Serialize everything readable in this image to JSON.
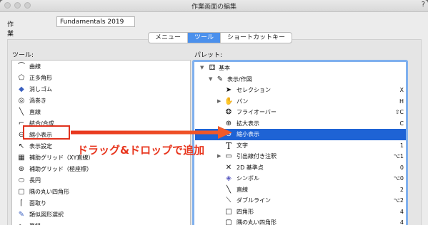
{
  "window": {
    "title": "作業画面の編集",
    "help": "?"
  },
  "name_field": {
    "label": "作業画面の名前:",
    "value": "Fundamentals 2019"
  },
  "tabs": [
    {
      "label": "メニュー",
      "active": false
    },
    {
      "label": "ツール",
      "active": true
    },
    {
      "label": "ショートカットキー",
      "active": false
    }
  ],
  "tools_panel": {
    "header": "ツール:",
    "items": [
      {
        "label": "曲線",
        "icon": "curve-icon"
      },
      {
        "label": "正多角形",
        "icon": "polygon-icon"
      },
      {
        "label": "消しゴム",
        "icon": "eraser-icon"
      },
      {
        "label": "渦巻き",
        "icon": "spiral-icon"
      },
      {
        "label": "直線",
        "icon": "line-icon"
      },
      {
        "label": "結合/合成",
        "icon": "combine-icon"
      },
      {
        "label": "縮小表示",
        "icon": "zoom-out-icon"
      },
      {
        "label": "表示設定",
        "icon": "view-settings-icon"
      },
      {
        "label": "補助グリッド（XY直線）",
        "icon": "grid-icon"
      },
      {
        "label": "補助グリッド（極座標）",
        "icon": "polar-grid-icon"
      },
      {
        "label": "長円",
        "icon": "oval-icon"
      },
      {
        "label": "隅の丸い四角形",
        "icon": "rounded-rect-icon"
      },
      {
        "label": "面取り",
        "icon": "chamfer-icon"
      },
      {
        "label": "類似図形選択",
        "icon": "similar-select-icon"
      },
      {
        "label": "登録",
        "icon": "register-icon"
      }
    ]
  },
  "palette_panel": {
    "header": "パレット:",
    "rows": [
      {
        "label": "基本",
        "shortcut": "",
        "indent": 0,
        "expander": "▼",
        "icon": "basic-icon"
      },
      {
        "label": "表示/作図",
        "shortcut": "",
        "indent": 1,
        "expander": "▼",
        "icon": "pencil-icon"
      },
      {
        "label": "セレクション",
        "shortcut": "X",
        "indent": 2,
        "expander": "",
        "icon": "selection-arrow-icon"
      },
      {
        "label": "パン",
        "shortcut": "H",
        "indent": 2,
        "expander": "▶",
        "icon": "hand-icon"
      },
      {
        "label": "フライオーバー",
        "shortcut": "⇧C",
        "indent": 2,
        "expander": "",
        "icon": "flyover-icon"
      },
      {
        "label": "拡大表示",
        "shortcut": "C",
        "indent": 2,
        "expander": "",
        "icon": "zoom-in-icon"
      },
      {
        "label": "縮小表示",
        "shortcut": "",
        "indent": 2,
        "expander": "",
        "icon": "zoom-out-icon",
        "selected": true
      },
      {
        "label": "文字",
        "shortcut": "1",
        "indent": 2,
        "expander": "",
        "icon": "text-icon"
      },
      {
        "label": "引出線付き注釈",
        "shortcut": "⌥1",
        "indent": 2,
        "expander": "▶",
        "icon": "callout-icon"
      },
      {
        "label": "2D 基準点",
        "shortcut": "0",
        "indent": 2,
        "expander": "",
        "icon": "locus-icon"
      },
      {
        "label": "シンボル",
        "shortcut": "⌥0",
        "indent": 2,
        "expander": "",
        "icon": "symbol-icon"
      },
      {
        "label": "直線",
        "shortcut": "2",
        "indent": 2,
        "expander": "",
        "icon": "line-icon"
      },
      {
        "label": "ダブルライン",
        "shortcut": "⌥2",
        "indent": 2,
        "expander": "",
        "icon": "double-line-icon"
      },
      {
        "label": "四角形",
        "shortcut": "4",
        "indent": 2,
        "expander": "",
        "icon": "rectangle-icon"
      },
      {
        "label": "隅の丸い四角形",
        "shortcut": "4",
        "indent": 2,
        "expander": "",
        "icon": "rounded-rect-icon"
      }
    ]
  },
  "annotation": {
    "text": "ドラッグ&ドロップで追加",
    "color": "#e8361e"
  }
}
